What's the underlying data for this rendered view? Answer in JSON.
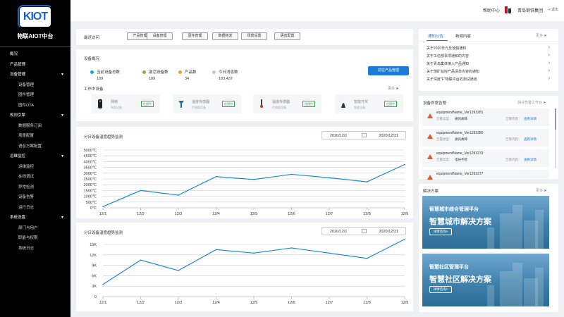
{
  "sidebar": {
    "logo_text": "KIOT",
    "brand": "物联AIOT中台",
    "items": [
      {
        "label": "概况",
        "level": 1,
        "caret": ""
      },
      {
        "label": "产品管理",
        "level": 1,
        "caret": ""
      },
      {
        "label": "设备管理",
        "level": 1,
        "caret": "▼"
      },
      {
        "label": "设备管理",
        "level": 2,
        "caret": ""
      },
      {
        "label": "固件管理",
        "level": 2,
        "caret": ""
      },
      {
        "label": "固件OTA",
        "level": 2,
        "caret": ""
      },
      {
        "label": "规则引擎",
        "level": 1,
        "caret": "▼"
      },
      {
        "label": "数据服务订阅",
        "level": 2,
        "caret": ""
      },
      {
        "label": "场景配置",
        "level": 2,
        "caret": ""
      },
      {
        "label": "语音方案配置",
        "level": 2,
        "caret": ""
      },
      {
        "label": "运维监控",
        "level": 1,
        "caret": "▼"
      },
      {
        "label": "运维监控",
        "level": 2,
        "caret": ""
      },
      {
        "label": "在线调试",
        "level": 2,
        "caret": ""
      },
      {
        "label": "异常检测",
        "level": 2,
        "caret": ""
      },
      {
        "label": "设备告警",
        "level": 2,
        "caret": ""
      },
      {
        "label": "运行日志",
        "level": 2,
        "caret": ""
      },
      {
        "label": "系统设置",
        "level": 1,
        "caret": "▼"
      },
      {
        "label": "部门与用户",
        "level": 2,
        "caret": ""
      },
      {
        "label": "职能与权限",
        "level": 2,
        "caret": ""
      },
      {
        "label": "系统日志",
        "level": 2,
        "caret": ""
      }
    ]
  },
  "header": {
    "help": "帮助中心",
    "org": "青岛钢铁集团",
    "exit": "退出"
  },
  "recent": {
    "label": "最近访问",
    "chips": [
      "产品管理",
      "设备管理",
      "固件管理",
      "数据转发",
      "场景设置",
      "语音配置"
    ]
  },
  "overview": {
    "title": "设备概况",
    "stats": [
      {
        "label": "当前设备总数",
        "value": "189",
        "color": "#1aa3e8"
      },
      {
        "label": "激活设备数",
        "value": "189",
        "color": "#7ab648"
      },
      {
        "label": "产品数",
        "value": "34",
        "color": "#f0a030"
      },
      {
        "label": "今日消息数",
        "value": "183,437",
        "color": "#c8c8c8"
      }
    ],
    "button": "前往产品管理",
    "work_title": "工作中设备",
    "more": "更多",
    "devices": [
      {
        "name": "网络",
        "desc": "网关设备",
        "status": "在线中"
      },
      {
        "name": "温度传感器",
        "desc": "传感器设备",
        "status": "在线中"
      },
      {
        "name": "温度传感器",
        "desc": "传感器设备",
        "status": "在线中"
      },
      {
        "name": "智能开关",
        "desc": "智能设备",
        "status": "在线中"
      }
    ]
  },
  "charts": [
    {
      "title": "分日设备温度趋势监测",
      "date_start": "2020/12/1",
      "date_end": "2020/12/31",
      "chart_data": {
        "type": "line",
        "categories": [
          "12/1",
          "12/2",
          "12/3",
          "12/4",
          "12/5",
          "12/6",
          "12/7",
          "12/8",
          "12/9"
        ],
        "values": [
          100,
          1500,
          1100,
          2700,
          2450,
          2900,
          2600,
          2250,
          3750
        ],
        "ylim": [
          0,
          5000
        ],
        "yticks": [
          "0℃",
          "500℃",
          "1000℃",
          "1500℃",
          "2000℃",
          "2500℃",
          "3000℃",
          "3500℃",
          "4000℃",
          "4500℃",
          "5000℃"
        ],
        "color": "#1a8ad0"
      }
    },
    {
      "title": "分日设备温度趋势监测",
      "date_start": "2020/12/1",
      "date_end": "2020/12/31",
      "chart_data": {
        "type": "line",
        "categories": [
          "12/1",
          "12/2",
          "12/3",
          "12/4",
          "12/5",
          "12/6",
          "12/7",
          "12/8",
          "12/9"
        ],
        "values": [
          3500,
          10500,
          7500,
          13500,
          12500,
          14000,
          12500,
          11000,
          16500
        ],
        "ylim": [
          0,
          15000
        ],
        "yticks": [
          "0",
          "3K",
          "6K",
          "9K",
          "12K",
          "15K"
        ],
        "color": "#1a8ad0"
      }
    }
  ],
  "notices": {
    "tabs": [
      "通知公告",
      "新闻内容"
    ],
    "more": "更多",
    "items": [
      "关于2020年元旦放假通知",
      "关于工信部事项通知的内容",
      "关于青岛集体接入产品通知",
      "关于煤矿监控产品清单内容的通知",
      "关于深度\"F\"物联中台的测试通道"
    ]
  },
  "alarms": {
    "title": "设备异常告警",
    "link": "前往告警工作台",
    "type_key": "告警类型：",
    "detail_key": "告警内容：",
    "detail_link": "查看详情",
    "items": [
      {
        "name": "equipmentName_Ver1293281",
        "type": "通讯故障"
      },
      {
        "name": "equipmentName_Ver1293280",
        "type": "通讯故障"
      },
      {
        "name": "equipmentName_Ver1293279",
        "type": "电压不稳"
      },
      {
        "name": "equipmentName_Ver1293277",
        "type": ""
      }
    ]
  },
  "solutions": {
    "title": "解决方案",
    "more": "更多",
    "banners": [
      {
        "title": "智慧城市综合管理平台",
        "subtitle": "智慧城市解决方案",
        "button": "详情咨询>"
      },
      {
        "title": "智慧社区管理平台",
        "subtitle": "智慧社区解决方案",
        "button": "详情咨询>"
      }
    ]
  }
}
